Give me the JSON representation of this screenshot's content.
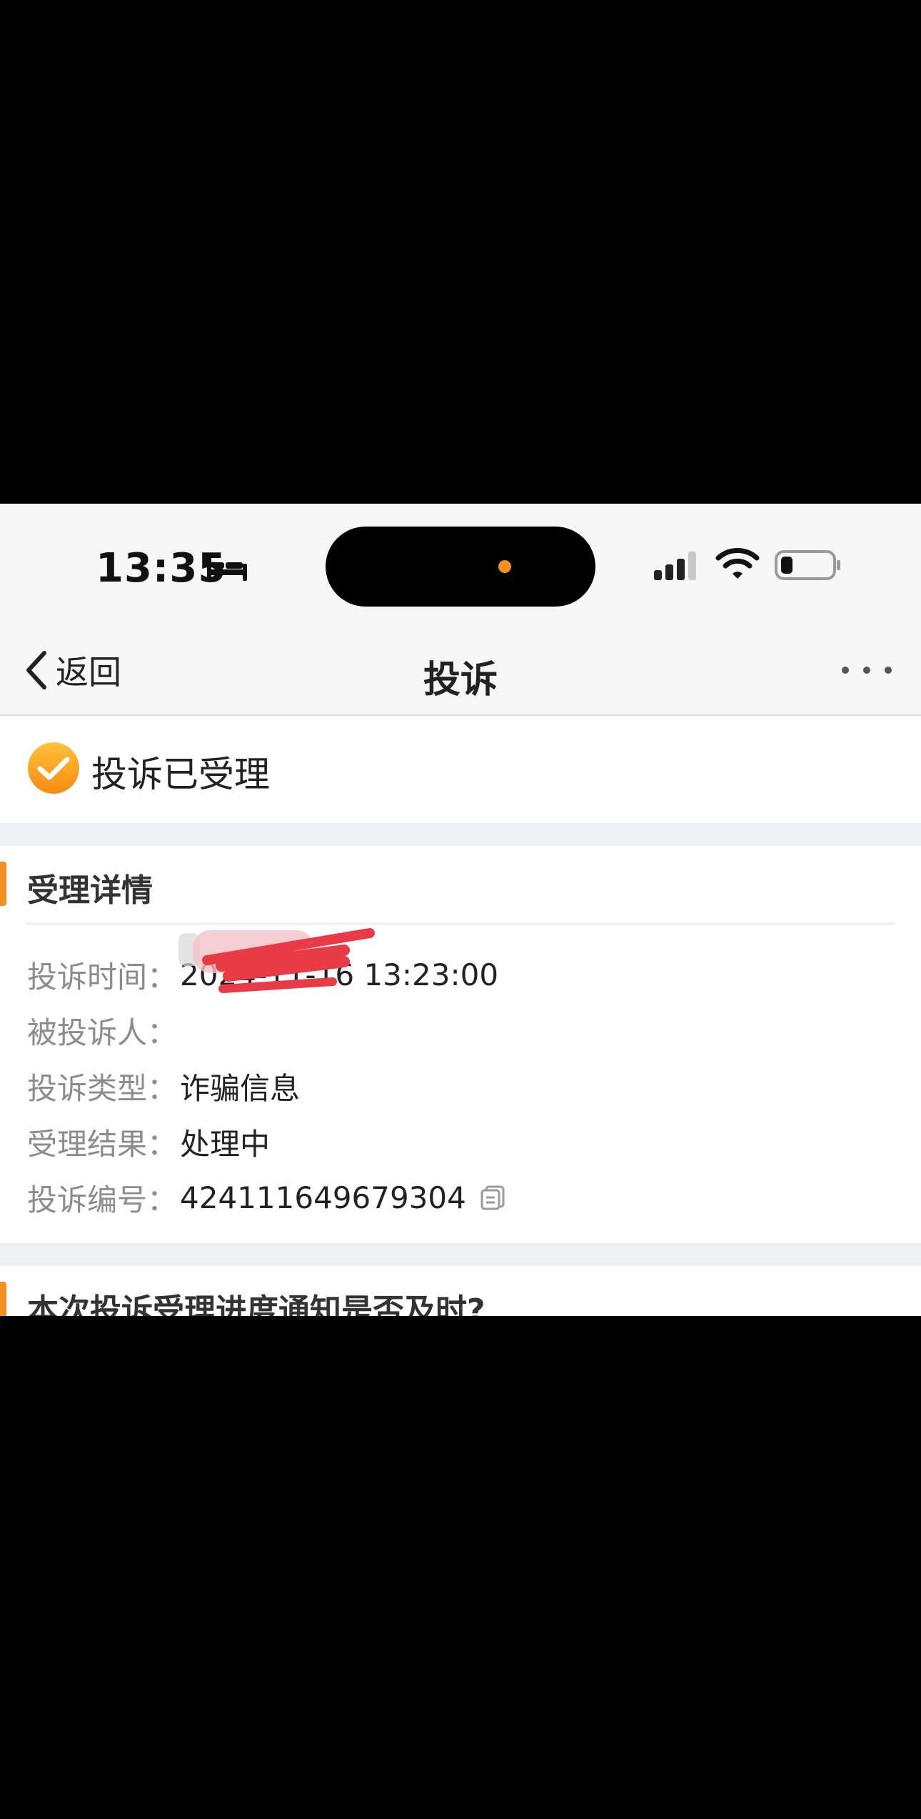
{
  "status_bar": {
    "time": "13:35",
    "icons": [
      "bed-icon",
      "signal-icon",
      "wifi-icon",
      "battery-icon"
    ],
    "island_dot_color": "#f5901e"
  },
  "nav": {
    "back_label": "返回",
    "title": "投诉",
    "more_icon": "more-icon"
  },
  "status": {
    "text": "投诉已受理",
    "icon": "check-circle-icon",
    "accent_color": "#f5901e"
  },
  "details": {
    "title": "受理详情",
    "rows": [
      {
        "label": "投诉时间：",
        "value": "2024-11-16 13:23:00"
      },
      {
        "label": "被投诉人：",
        "value": ""
      },
      {
        "label": "投诉类型：",
        "value": "诈骗信息"
      },
      {
        "label": "受理结果：",
        "value": "处理中"
      },
      {
        "label": "投诉编号：",
        "value": "424111649679304"
      }
    ]
  },
  "feedback": {
    "question": "本次投诉受理进度通知是否及时?"
  }
}
